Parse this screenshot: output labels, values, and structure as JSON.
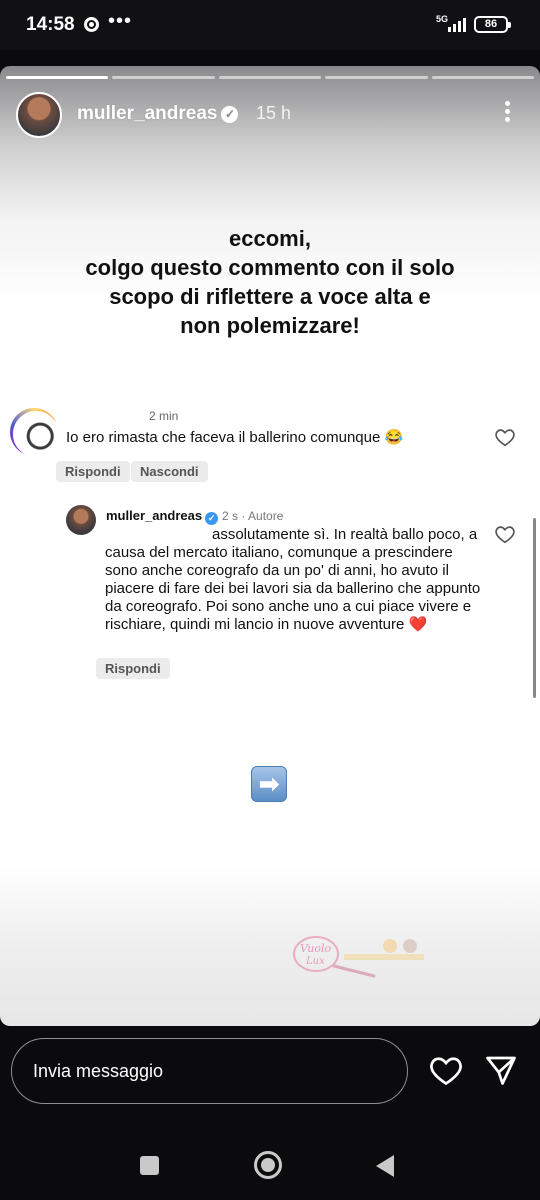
{
  "status_bar": {
    "time": "14:58",
    "network": "5G",
    "battery": "86"
  },
  "story": {
    "username": "muller_andreas",
    "time_ago": "15 h",
    "caption_lines": [
      "eccomi,",
      "colgo questo commento con il solo",
      "scopo di riflettere a voce alta e",
      "non polemizzare!"
    ],
    "progress_segments": 5,
    "progress_done": 1
  },
  "comment": {
    "time": "2 min",
    "text": "Io ero rimasta che faceva il ballerino comunque 😂",
    "reply_label": "Rispondi",
    "hide_label": "Nascondi"
  },
  "reply": {
    "username": "muller_andreas",
    "time": "2 s",
    "author_tag": "Autore",
    "text": "assolutamente sì. In realtà ballo poco, a causa del mercato italiano, comunque a prescindere sono anche coreografo da un po' di anni, ho avuto il piacere di fare dei bei lavori sia da ballerino che appunto da coreografo. Poi sono anche uno a cui piace vivere e rischiare, quindi mi lancio in nuove avventure ❤️",
    "reply_label": "Rispondi"
  },
  "message_bar": {
    "placeholder": "Invia messaggio"
  },
  "colors": {
    "background": "#0b0b0d",
    "verified_blue": "#3897f0",
    "chip_bg": "#ececec"
  },
  "icons": [
    "chrome-icon",
    "more-dots-icon",
    "signal-icon",
    "battery-icon",
    "verified-icon",
    "heart-icon",
    "send-icon",
    "right-arrow-emoji",
    "nav-recents-icon",
    "nav-home-icon",
    "nav-back-icon"
  ]
}
